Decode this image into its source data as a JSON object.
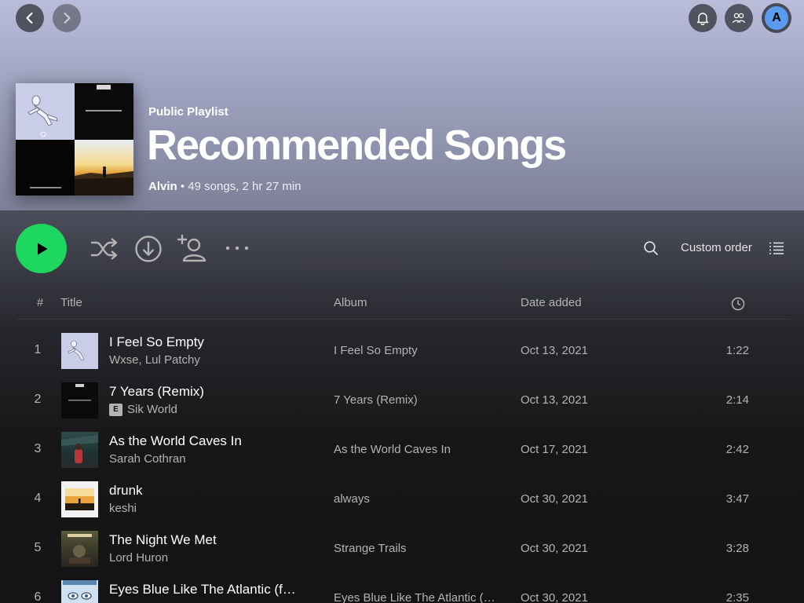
{
  "colors": {
    "accent": "#1ed760",
    "avatar": "#5a9bf0"
  },
  "top_bar": {
    "back_icon": "chevron-left-icon",
    "forward_icon": "chevron-right-icon",
    "notifications_icon": "bell-icon",
    "friends_icon": "people-icon",
    "avatar_initial": "A"
  },
  "playlist": {
    "type_label": "Public Playlist",
    "title": "Recommended Songs",
    "owner": "Alvin",
    "separator": " • ",
    "stats": "49 songs, 2 hr 27 min"
  },
  "controls": {
    "play_icon": "play-icon",
    "shuffle_icon": "shuffle-icon",
    "download_icon": "download-icon",
    "add_user_icon": "add-user-icon",
    "more_icon": "more-icon",
    "search_icon": "search-icon",
    "sort_label": "Custom order",
    "sort_icon": "list-icon"
  },
  "columns": {
    "index": "#",
    "title": "Title",
    "album": "Album",
    "date_added": "Date added",
    "duration_icon": "clock-icon"
  },
  "tracks": [
    {
      "index": "1",
      "title": "I Feel So Empty",
      "artist": "Wxse, Lul Patchy",
      "explicit": false,
      "album": "I Feel So Empty",
      "date_added": "Oct 13, 2021",
      "duration": "1:22"
    },
    {
      "index": "2",
      "title": "7 Years (Remix)",
      "artist": "Sik World",
      "explicit": true,
      "explicit_label": "E",
      "album": "7 Years (Remix)",
      "date_added": "Oct 13, 2021",
      "duration": "2:14"
    },
    {
      "index": "3",
      "title": "As the World Caves In",
      "artist": "Sarah Cothran",
      "explicit": false,
      "album": "As the World Caves In",
      "date_added": "Oct 17, 2021",
      "duration": "2:42"
    },
    {
      "index": "4",
      "title": "drunk",
      "artist": "keshi",
      "explicit": false,
      "album": "always",
      "date_added": "Oct 30, 2021",
      "duration": "3:47"
    },
    {
      "index": "5",
      "title": "The Night We Met",
      "artist": "Lord Huron",
      "explicit": false,
      "album": "Strange Trails",
      "date_added": "Oct 30, 2021",
      "duration": "3:28"
    },
    {
      "index": "6",
      "title": "Eyes Blue Like The Atlantic (f…",
      "artist": "",
      "explicit": false,
      "album": "Eyes Blue Like The Atlantic (…",
      "date_added": "Oct 30, 2021",
      "duration": "2:35"
    }
  ]
}
